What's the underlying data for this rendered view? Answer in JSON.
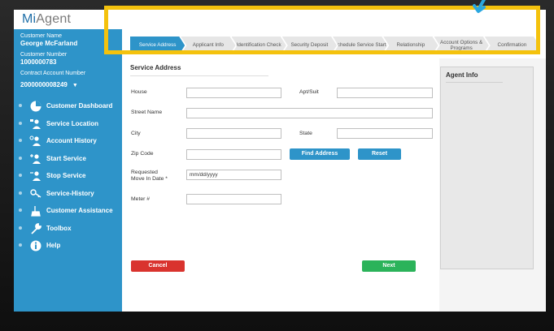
{
  "app": {
    "logo_prefix": "Mi",
    "logo_suffix": "Agent"
  },
  "customer": {
    "name_label": "Customer Name",
    "name_value": "George McFarland",
    "number_label": "Customer Number",
    "number_value": "1000000783",
    "contract_label": "Contract Account Number",
    "contract_value": "2000000008249"
  },
  "menu": [
    {
      "label": "Customer Dashboard",
      "icon": "pie-chart-icon"
    },
    {
      "label": "Service Location",
      "icon": "person-map-icon"
    },
    {
      "label": "Account History",
      "icon": "person-history-icon"
    },
    {
      "label": "Start Service",
      "icon": "person-plus-icon"
    },
    {
      "label": "Stop Service",
      "icon": "person-minus-icon"
    },
    {
      "label": "Service-History",
      "icon": "key-icon"
    },
    {
      "label": "Customer Assistance",
      "icon": "hand-icon"
    },
    {
      "label": "Toolbox",
      "icon": "wrench-icon"
    },
    {
      "label": "Help",
      "icon": "info-icon"
    }
  ],
  "steps": [
    {
      "label": "Service Address",
      "active": true
    },
    {
      "label": "Applicant Info",
      "active": false
    },
    {
      "label": "Identification Check",
      "active": false
    },
    {
      "label": "Security Deposit",
      "active": false
    },
    {
      "label": "Schedule Service Start",
      "active": false
    },
    {
      "label": "Relationship",
      "active": false
    },
    {
      "label": "Account Options & Programs",
      "active": false
    },
    {
      "label": "Confirmation",
      "active": false
    }
  ],
  "form": {
    "section_title": "Service Address",
    "house_label": "House",
    "apt_label": "Apt/Suit",
    "street_label": "Street Name",
    "city_label": "City",
    "state_label": "State",
    "zip_label": "Zip Code",
    "find_address_label": "Find Address",
    "reset_label": "Reset",
    "move_in_label_1": "Requested",
    "move_in_label_2": "Move In Date *",
    "move_in_value": "mm/dd/yyyy",
    "meter_label": "Meter #",
    "cancel_label": "Cancel",
    "next_label": "Next"
  },
  "agent": {
    "title": "Agent Info"
  },
  "colors": {
    "accent": "#2e94c9",
    "highlight": "#f4c20d",
    "cancel": "#d9332e",
    "next": "#2bb35a"
  }
}
